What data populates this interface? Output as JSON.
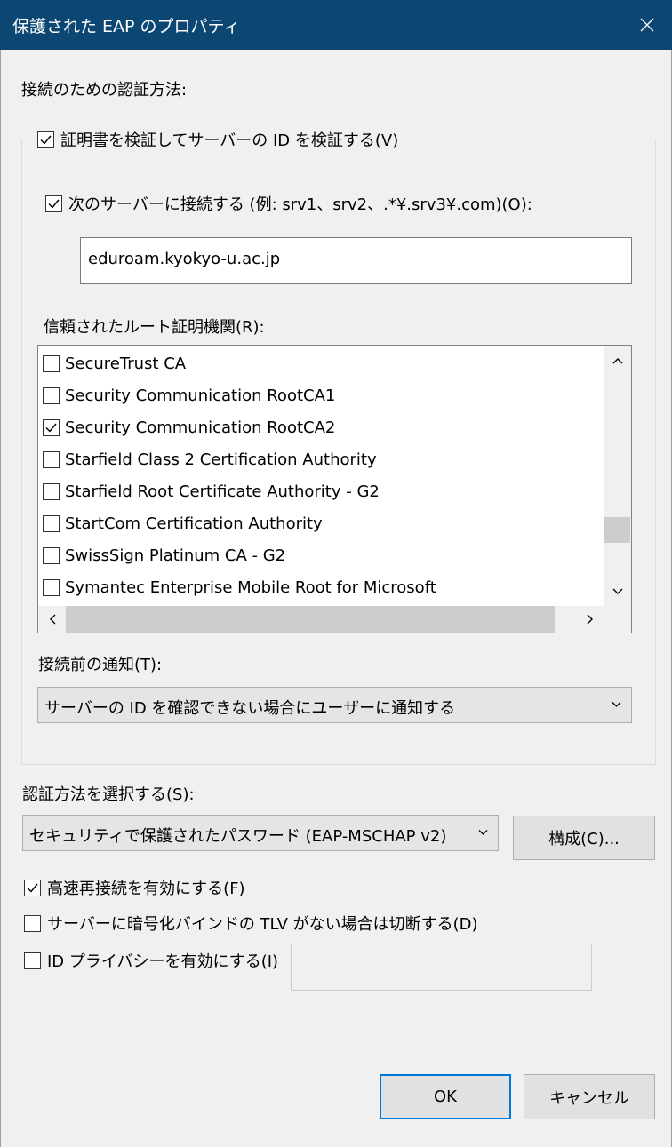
{
  "window": {
    "title": "保護された EAP のプロパティ",
    "close_icon": "close-icon"
  },
  "auth_method_heading": "接続のための認証方法:",
  "verify_cert": {
    "label": "証明書を検証してサーバーの ID を検証する(V)",
    "checked": true
  },
  "connect_servers": {
    "label": "次のサーバーに接続する (例: srv1、srv2、.*¥.srv3¥.com)(O):",
    "checked": true
  },
  "server_field": {
    "value": "eduroam.kyokyo-u.ac.jp"
  },
  "trusted_roots": {
    "label": "信頼されたルート証明機関(R):",
    "items": [
      {
        "label": "SecureTrust CA",
        "checked": false
      },
      {
        "label": "Security Communication RootCA1",
        "checked": false
      },
      {
        "label": "Security Communication RootCA2",
        "checked": true
      },
      {
        "label": "Starfield Class 2 Certification Authority",
        "checked": false
      },
      {
        "label": "Starfield Root Certificate Authority - G2",
        "checked": false
      },
      {
        "label": "StartCom Certification Authority",
        "checked": false
      },
      {
        "label": "SwissSign Platinum CA - G2",
        "checked": false
      },
      {
        "label": "Symantec Enterprise Mobile Root for Microsoft",
        "checked": false
      }
    ]
  },
  "notify": {
    "label": "接続前の通知(T):",
    "selected": "サーバーの ID を確認できない場合にユーザーに通知する"
  },
  "select_method": {
    "label": "認証方法を選択する(S):",
    "selected": "セキュリティで保護されたパスワード (EAP-MSCHAP v2)",
    "configure_button": "構成(C)..."
  },
  "options": [
    {
      "label": "高速再接続を有効にする(F)",
      "checked": true
    },
    {
      "label": "サーバーに暗号化バインドの TLV がない場合は切断する(D)",
      "checked": false
    },
    {
      "label": "ID プライバシーを有効にする(I)",
      "checked": false
    }
  ],
  "footer": {
    "ok": "OK",
    "cancel": "キャンセル"
  }
}
